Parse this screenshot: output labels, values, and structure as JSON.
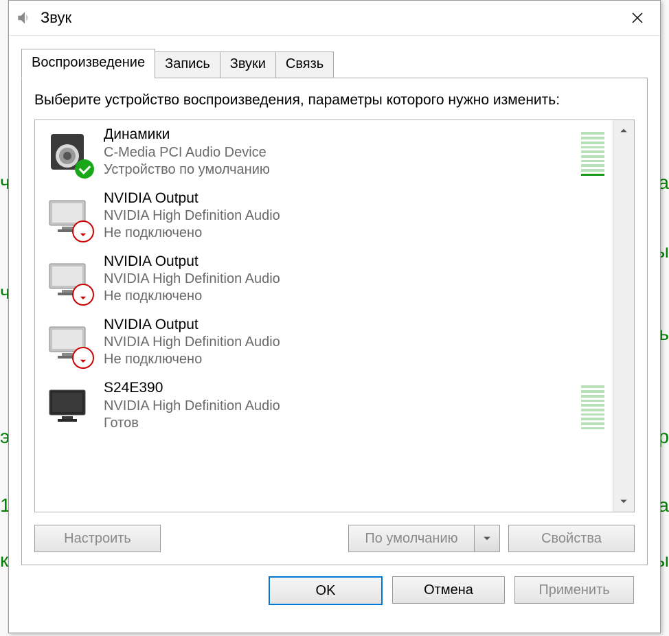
{
  "window": {
    "title": "Звук"
  },
  "tabs": [
    {
      "label": "Воспроизведение",
      "active": true
    },
    {
      "label": "Запись",
      "active": false
    },
    {
      "label": "Звуки",
      "active": false
    },
    {
      "label": "Связь",
      "active": false
    }
  ],
  "instruction": "Выберите устройство воспроизведения, параметры которого нужно изменить:",
  "devices": [
    {
      "name": "Динамики",
      "desc": "C-Media PCI Audio Device",
      "status": "Устройство по умолчанию",
      "icon": "speaker",
      "badge": "default",
      "meter": true
    },
    {
      "name": "NVIDIA Output",
      "desc": "NVIDIA High Definition Audio",
      "status": "Не подключено",
      "icon": "monitor-off",
      "badge": "disconnected",
      "meter": false
    },
    {
      "name": "NVIDIA Output",
      "desc": "NVIDIA High Definition Audio",
      "status": "Не подключено",
      "icon": "monitor-off",
      "badge": "disconnected",
      "meter": false
    },
    {
      "name": "NVIDIA Output",
      "desc": "NVIDIA High Definition Audio",
      "status": "Не подключено",
      "icon": "monitor-off",
      "badge": "disconnected",
      "meter": false
    },
    {
      "name": "S24E390",
      "desc": "NVIDIA High Definition Audio",
      "status": "Готов",
      "icon": "monitor-on",
      "badge": null,
      "meter": true
    }
  ],
  "buttons": {
    "configure": "Настроить",
    "set_default": "По умолчанию",
    "properties": "Свойства",
    "ok": "OK",
    "cancel": "Отмена",
    "apply": "Применить"
  }
}
